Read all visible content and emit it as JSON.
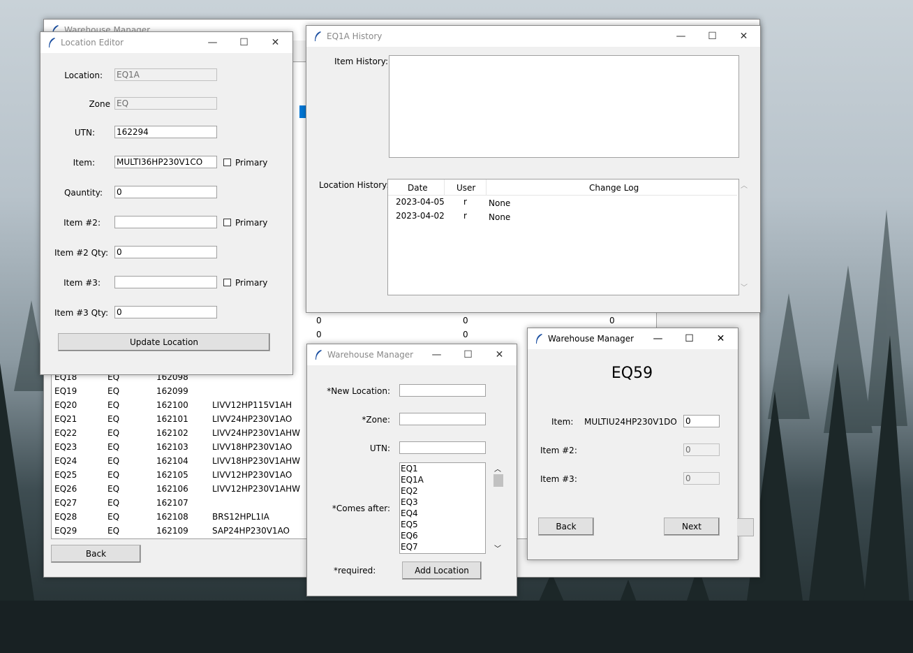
{
  "colors": {
    "selection": "#0078d7",
    "window_bg": "#f0f0f0",
    "inactive_title": "#888888"
  },
  "main_window": {
    "title": "Warehouse Manager",
    "back_label": "Back",
    "rows": [
      {
        "loc": "EQ18",
        "zone": "EQ",
        "utn": "162098",
        "item": ""
      },
      {
        "loc": "EQ19",
        "zone": "EQ",
        "utn": "162099",
        "item": ""
      },
      {
        "loc": "EQ20",
        "zone": "EQ",
        "utn": "162100",
        "item": "LIVV12HP115V1AH"
      },
      {
        "loc": "EQ21",
        "zone": "EQ",
        "utn": "162101",
        "item": "LIVV24HP230V1AO"
      },
      {
        "loc": "EQ22",
        "zone": "EQ",
        "utn": "162102",
        "item": "LIVV24HP230V1AHW"
      },
      {
        "loc": "EQ23",
        "zone": "EQ",
        "utn": "162103",
        "item": "LIVV18HP230V1AO"
      },
      {
        "loc": "EQ24",
        "zone": "EQ",
        "utn": "162104",
        "item": "LIVV18HP230V1AHW"
      },
      {
        "loc": "EQ25",
        "zone": "EQ",
        "utn": "162105",
        "item": "LIVV12HP230V1AO"
      },
      {
        "loc": "EQ26",
        "zone": "EQ",
        "utn": "162106",
        "item": "LIVV12HP230V1AHW"
      },
      {
        "loc": "EQ27",
        "zone": "EQ",
        "utn": "162107",
        "item": ""
      },
      {
        "loc": "EQ28",
        "zone": "EQ",
        "utn": "162108",
        "item": "BRS12HPL1IA"
      },
      {
        "loc": "EQ29",
        "zone": "EQ",
        "utn": "162109",
        "item": "SAP24HP230V1AO"
      }
    ],
    "zero_rows": [
      {
        "a": "0",
        "b": "0",
        "c": "0"
      },
      {
        "a": "0",
        "b": "0",
        "c": ""
      }
    ]
  },
  "location_editor": {
    "title": "Location Editor",
    "location_label": "Location:",
    "location_value": "EQ1A",
    "zone_label": "Zone",
    "zone_value": "EQ",
    "utn_label": "UTN:",
    "utn_value": "162294",
    "item_label": "Item:",
    "item_value": "MULTI36HP230V1CO",
    "quantity_label": "Qauntity:",
    "quantity_value": "0",
    "item2_label": "Item #2:",
    "item2_value": "",
    "item2_qty_label": "Item #2 Qty:",
    "item2_qty_value": "0",
    "item3_label": "Item #3:",
    "item3_value": "",
    "item3_qty_label": "Item #3 Qty:",
    "item3_qty_value": "0",
    "primary_label": "Primary",
    "update_label": "Update Location"
  },
  "history": {
    "title": "EQ1A History",
    "item_history_label": "Item History:",
    "location_history_label": "Location History:",
    "columns": [
      "Date",
      "User",
      "Change Log"
    ],
    "rows": [
      {
        "date": "2023-04-05",
        "user": "r",
        "log": "None"
      },
      {
        "date": "2023-04-02",
        "user": "r",
        "log": "None"
      }
    ]
  },
  "add_location": {
    "title": "Warehouse Manager",
    "new_location_label": "*New Location:",
    "zone_label": "*Zone:",
    "utn_label": "UTN:",
    "comes_after_label": "*Comes after:",
    "options": [
      "EQ1",
      "EQ1A",
      "EQ2",
      "EQ3",
      "EQ4",
      "EQ5",
      "EQ6",
      "EQ7"
    ],
    "required_label": "*required:",
    "add_label": "Add Location"
  },
  "eq59": {
    "title": "Warehouse Manager",
    "heading": "EQ59",
    "item_label": "Item:",
    "item_name": "MULTIU24HP230V1DO",
    "item_qty": "0",
    "item2_label": "Item #2:",
    "item2_qty": "0",
    "item3_label": "Item #3:",
    "item3_qty": "0",
    "back_label": "Back",
    "next_label": "Next"
  }
}
